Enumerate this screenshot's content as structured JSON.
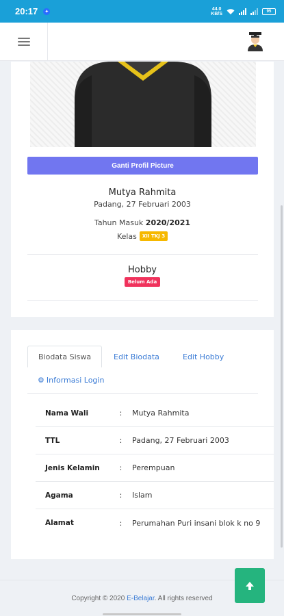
{
  "status_bar": {
    "time": "20:17",
    "speed_top": "44.0",
    "speed_bottom": "KB/S",
    "battery": "95"
  },
  "header": {
    "menu_icon": "hamburger-icon",
    "avatar_icon": "graduate-avatar-icon"
  },
  "profile": {
    "change_photo_label": "Ganti Profil Picture",
    "name": "Mutya Rahmita",
    "birth": "Padang, 27 Februari 2003",
    "year_label": "Tahun Masuk",
    "year_value": "2020/2021",
    "class_label": "Kelas",
    "class_value": "XII TKJ 3",
    "hobby_title": "Hobby",
    "hobby_status": "Belum Ada"
  },
  "tabs": [
    {
      "label": "Biodata Siswa",
      "active": true
    },
    {
      "label": "Edit Biodata",
      "active": false
    },
    {
      "label": "Edit Hobby",
      "active": false
    },
    {
      "label": "Informasi Login",
      "active": false,
      "icon": "gears-icon"
    }
  ],
  "biodata": {
    "rows": [
      {
        "label": "Nama Wali",
        "colon": ":",
        "value": "Mutya Rahmita"
      },
      {
        "label": "TTL",
        "colon": ":",
        "value": "Padang, 27 Februari 2003"
      },
      {
        "label": "Jenis Kelamin",
        "colon": ":",
        "value": "Perempuan"
      },
      {
        "label": "Agama",
        "colon": ":",
        "value": "Islam"
      },
      {
        "label": "Alamat",
        "colon": ":",
        "value": "Perumahan Puri insani blok k no 9"
      }
    ]
  },
  "footer": {
    "copyright": "Copyright © 2020",
    "brand": "E-Belajar",
    "rights": ". All rights reserved"
  },
  "colors": {
    "status_bar": "#1aa0d8",
    "primary_button": "#7176f0",
    "badge_class": "#f6b800",
    "badge_hobby": "#f0325c",
    "link": "#3a7bd5",
    "scroll_top": "#25b47e"
  }
}
